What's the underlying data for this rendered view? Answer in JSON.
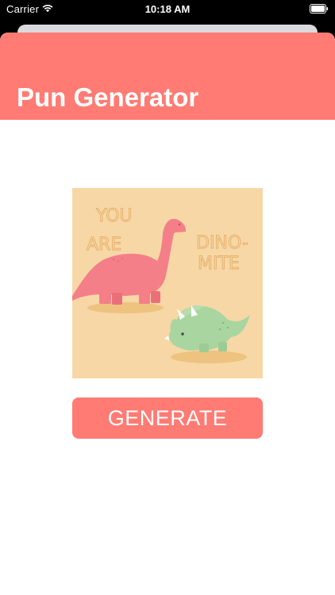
{
  "status_bar": {
    "carrier": "Carrier",
    "time": "10:18 AM",
    "wifi_icon": "wifi-icon",
    "battery_icon": "battery-icon"
  },
  "nav": {
    "title": "Pun Generator"
  },
  "pun_image": {
    "lines": [
      "YOU",
      "ARE",
      "DINO-",
      "MITE"
    ],
    "icon": "dinosaur-illustration"
  },
  "generate_button": {
    "label": "GENERATE"
  },
  "colors": {
    "accent": "#ff7b73",
    "image_background": "#f7d7a6",
    "pun_text": "#e3a85b",
    "dino_pink": "#f47f88",
    "dino_green": "#a9d5a0",
    "shadow": "#eec37f"
  }
}
